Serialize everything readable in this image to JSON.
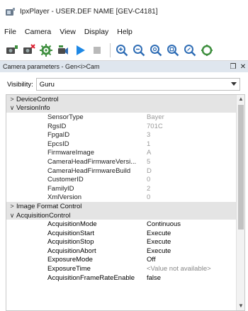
{
  "window": {
    "title": "IpxPlayer - USER.DEF NAME [GEV-C4181]"
  },
  "menu": [
    {
      "label": "File"
    },
    {
      "label": "Camera"
    },
    {
      "label": "View"
    },
    {
      "label": "Display"
    },
    {
      "label": "Help"
    }
  ],
  "toolbar": {
    "icons": [
      "camera-connect-icon",
      "camera-disconnect-icon",
      "camera-settings-icon",
      "camera-network-icon",
      "play-icon",
      "stop-icon",
      "zoom-in-icon",
      "zoom-out-icon",
      "zoom-fit-icon",
      "zoom-100-icon",
      "zoom-custom-icon",
      "more-icon"
    ],
    "colors": {
      "play": "#1e88e5",
      "zoom": "#2f6db5",
      "icon_dark": "#4a4a4a",
      "icon_green": "#3f8f3f"
    }
  },
  "dock": {
    "title": "Camera parameters - Gen<i>Cam",
    "float_label": "❒",
    "close_label": "✕"
  },
  "visibility": {
    "label": "Visibility:",
    "value": "Guru"
  },
  "tree": {
    "rows": [
      {
        "kind": "category",
        "expanded": false,
        "name": "DeviceControl"
      },
      {
        "kind": "category",
        "expanded": true,
        "name": "VersionInfo"
      },
      {
        "kind": "feature",
        "disabled": true,
        "name": "SensorType",
        "value": "Bayer"
      },
      {
        "kind": "feature",
        "disabled": true,
        "name": "RgsID",
        "value": "701C"
      },
      {
        "kind": "feature",
        "disabled": true,
        "name": "FpgaID",
        "value": "3"
      },
      {
        "kind": "feature",
        "disabled": true,
        "name": "EpcsID",
        "value": "1"
      },
      {
        "kind": "feature",
        "disabled": true,
        "name": "FirmwareImage",
        "value": "A"
      },
      {
        "kind": "feature",
        "disabled": true,
        "name": "CameraHeadFirmwareVersi...",
        "value": "5"
      },
      {
        "kind": "feature",
        "disabled": true,
        "name": "CameraHeadFirmwareBuild",
        "value": "D"
      },
      {
        "kind": "feature",
        "disabled": true,
        "name": "CustomerID",
        "value": "0"
      },
      {
        "kind": "feature",
        "disabled": true,
        "name": "FamilyID",
        "value": "2"
      },
      {
        "kind": "feature",
        "disabled": true,
        "name": "XmlVersion",
        "value": "0"
      },
      {
        "kind": "category",
        "expanded": false,
        "name": "Image Format Control"
      },
      {
        "kind": "category",
        "expanded": true,
        "name": "AcquisitionControl"
      },
      {
        "kind": "feature",
        "disabled": false,
        "name": "AcquisitionMode",
        "value": "Continuous"
      },
      {
        "kind": "feature",
        "disabled": false,
        "name": "AcquisitionStart",
        "value": "Execute"
      },
      {
        "kind": "feature",
        "disabled": false,
        "name": "AcquisitionStop",
        "value": "Execute"
      },
      {
        "kind": "feature",
        "disabled": false,
        "name": "AcquisitionAbort",
        "value": "Execute"
      },
      {
        "kind": "feature",
        "disabled": false,
        "name": "ExposureMode",
        "value": "Off"
      },
      {
        "kind": "feature",
        "disabled": false,
        "name": "ExposureTime",
        "value": "<Value not available>",
        "na": true
      },
      {
        "kind": "feature",
        "disabled": false,
        "name": "AcquisitionFrameRateEnable",
        "value": "false"
      }
    ]
  }
}
